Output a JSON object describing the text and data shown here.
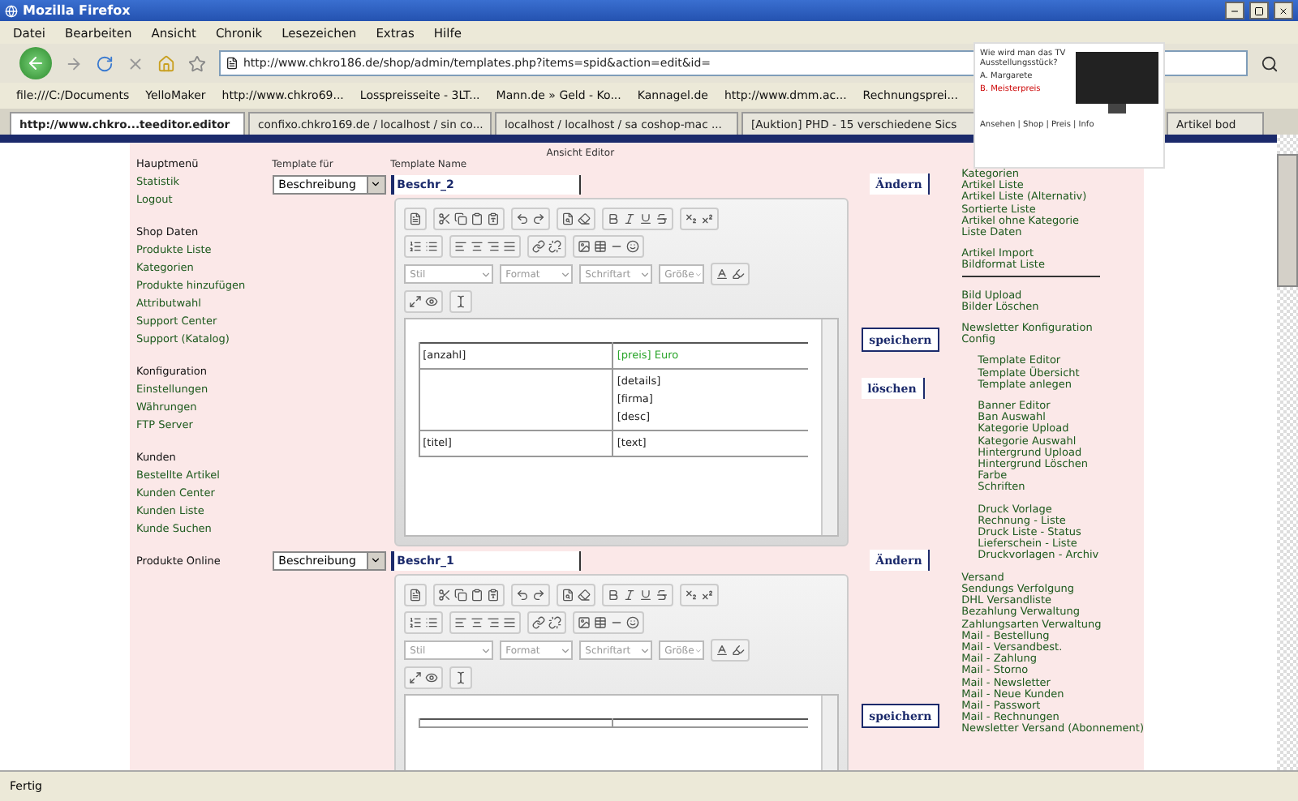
{
  "window": {
    "title": "Mozilla Firefox"
  },
  "menu": [
    "Datei",
    "Bearbeiten",
    "Ansicht",
    "Chronik",
    "Lesezeichen",
    "Extras",
    "Hilfe"
  ],
  "navigation": {
    "url": "http://www.chkro186.de/shop/admin/templates.php?items=spid&action=edit&id="
  },
  "bookmarks": [
    "file:///C:/Documents",
    "YelloMaker",
    "http://www.chkro69...",
    "Losspreisseite - 3LT...",
    "Mann.de » Geld - Ko...",
    "Kannagel.de",
    "http://www.dmm.ac...",
    "Rechnungsprei..."
  ],
  "tabs": [
    {
      "label": "http://www.chkro...teeditor.editor",
      "selected": true
    },
    {
      "label": "confixo.chkro169.de / localhost / sin co...",
      "selected": false
    },
    {
      "label": "localhost / localhost / sa coshop-mac ...",
      "selected": false
    },
    {
      "label": "[Auktion] PHD - 15 verschiedene Sics",
      "selected": false
    },
    {
      "label": "Artikel bod",
      "selected": false
    }
  ],
  "ad": {
    "question": "Wie wird man das TV Ausstellungsstück?",
    "options": [
      "A. Margarete",
      "B. Meisterpreis"
    ],
    "footer": "Ansehen | Shop | Preis | Info"
  },
  "left_nav": [
    {
      "heading": "Hauptmenü",
      "items": [
        "Statistik",
        "Logout"
      ]
    },
    {
      "heading": "Shop Daten",
      "items": [
        "Produkte Liste",
        "Kategorien",
        "Produkte hinzufügen",
        "Attributwahl",
        "Support Center",
        "Support (Katalog)"
      ]
    },
    {
      "heading": "Konfiguration",
      "items": [
        "Einstellungen",
        "Währungen",
        "FTP Server"
      ]
    },
    {
      "heading": "Kunden",
      "items": [
        "Bestellte Artikel",
        "Kunden Center",
        "Kunden Liste",
        "Kunde Suchen"
      ]
    },
    {
      "heading": "Produkte Online"
    }
  ],
  "editor_page": {
    "title": "Ansicht Editor",
    "type_label": "Template für",
    "name_label": "Template Name"
  },
  "templates": [
    {
      "type": "Beschreibung",
      "name": "Beschr_2",
      "change_button": "Ändern",
      "combos": [
        "Stil",
        "Format",
        "Schriftart",
        "Größe"
      ],
      "rows": [
        {
          "left": "[anzahl]",
          "right": [
            "[preis] Euro"
          ],
          "highlight": true
        },
        {
          "right": [
            "[details]",
            "[firma]",
            "[desc]"
          ],
          "highlight": false
        },
        {
          "left": "[titel]",
          "right": [
            "[text]"
          ],
          "highlight": false
        }
      ],
      "buttons": [
        "speichern",
        "löschen"
      ]
    },
    {
      "type": "Beschreibung",
      "name": "Beschr_1",
      "change_button": "Ändern",
      "combos": [
        "Stil",
        "Format",
        "Schriftart",
        "Größe"
      ],
      "buttons": [
        "speichern"
      ]
    }
  ],
  "right_nav": [
    {
      "indented": false,
      "divider": false,
      "items": [
        "Kategorien",
        "Artikel Liste",
        "Artikel Liste (Alternativ)",
        "Sortierte Liste",
        "Artikel ohne Kategorie",
        "Liste Daten"
      ]
    },
    {
      "indented": false,
      "divider": true,
      "items": [
        "Artikel Import",
        "Bildformat Liste"
      ]
    },
    {
      "indented": false,
      "divider": false,
      "items": [
        "Bild Upload",
        "Bilder Löschen"
      ]
    },
    {
      "indented": false,
      "divider": false,
      "items": [
        "Newsletter Konfiguration",
        "Config"
      ]
    },
    {
      "indented": true,
      "divider": false,
      "items": [
        "Template Editor",
        "Template Übersicht",
        "Template anlegen"
      ]
    },
    {
      "indented": true,
      "divider": false,
      "items": [
        "Banner Editor",
        "Ban Auswahl",
        "Kategorie Upload",
        "Kategorie Auswahl",
        "Hintergrund Upload",
        "Hintergrund Löschen",
        "Farbe",
        "Schriften"
      ]
    },
    {
      "indented": true,
      "divider": false,
      "items": [
        "Druck Vorlage",
        "Rechnung - Liste",
        "Druck Liste - Status",
        "Lieferschein - Liste",
        "Druckvorlagen - Archiv"
      ]
    },
    {
      "indented": false,
      "divider": false,
      "items": [
        "Versand",
        "Sendungs Verfolgung",
        "DHL Versandliste",
        "Bezahlung Verwaltung",
        "Zahlungsarten Verwaltung",
        "Mail - Bestellung",
        "Mail - Versandbest.",
        "Mail - Zahlung",
        "Mail - Storno",
        "Mail - Newsletter",
        "Mail - Neue Kunden",
        "Mail - Passwort",
        "Mail - Rechnungen",
        "Newsletter Versand (Abonnement)"
      ]
    }
  ],
  "status_bar": "Fertig"
}
